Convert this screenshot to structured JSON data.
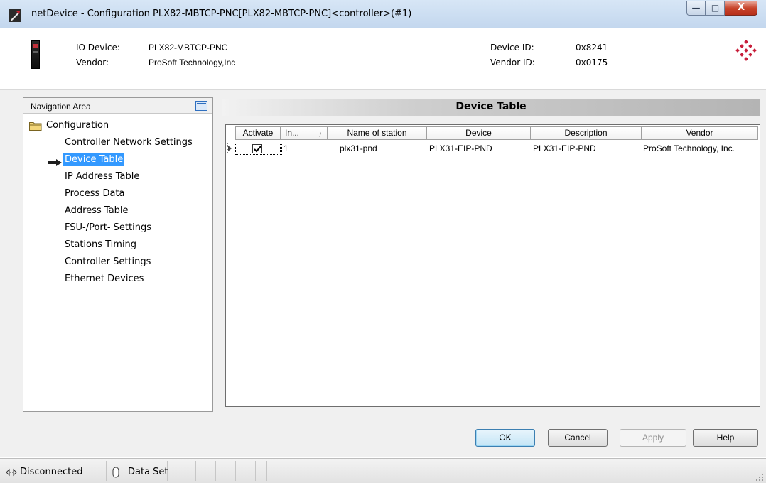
{
  "window": {
    "title": "netDevice - Configuration PLX82-MBTCP-PNC[PLX82-MBTCP-PNC]<controller>(#1)",
    "controls": {
      "minimize": "—",
      "maximize": "□",
      "close": "X"
    }
  },
  "device_info": {
    "io_device_label": "IO Device:",
    "io_device_value": "PLX82-MBTCP-PNC",
    "vendor_label": "Vendor:",
    "vendor_value": "ProSoft Technology,Inc",
    "device_id_label": "Device ID:",
    "device_id_value": "0x8241",
    "vendor_id_label": "Vendor ID:",
    "vendor_id_value": "0x0175"
  },
  "navigation": {
    "header": "Navigation Area",
    "root": "Configuration",
    "items": [
      {
        "label": "Controller Network Settings",
        "selected": false
      },
      {
        "label": "Device Table",
        "selected": true
      },
      {
        "label": "IP Address Table",
        "selected": false
      },
      {
        "label": "Process Data",
        "selected": false
      },
      {
        "label": "Address Table",
        "selected": false
      },
      {
        "label": "FSU-/Port- Settings",
        "selected": false
      },
      {
        "label": "Stations Timing",
        "selected": false
      },
      {
        "label": "Controller Settings",
        "selected": false
      },
      {
        "label": "Ethernet Devices",
        "selected": false
      }
    ]
  },
  "device_table": {
    "title": "Device Table",
    "columns": [
      "Activate",
      "In...",
      "Name of station",
      "Device",
      "Description",
      "Vendor"
    ],
    "sort_indicator": "/",
    "rows": [
      {
        "activate": true,
        "index": "1",
        "name_of_station": "plx31-pnd",
        "device": "PLX31-EIP-PND",
        "description": "PLX31-EIP-PND",
        "vendor": "ProSoft Technology, Inc."
      }
    ]
  },
  "buttons": {
    "ok": "OK",
    "cancel": "Cancel",
    "apply": "Apply",
    "help": "Help"
  },
  "status_bar": {
    "connection": "Disconnected",
    "data_set": "Data Set"
  },
  "colors": {
    "selection": "#3399ff",
    "title_bar": "#c3d7ee",
    "close_button": "#c7432a",
    "logo_red": "#c81e3a"
  }
}
